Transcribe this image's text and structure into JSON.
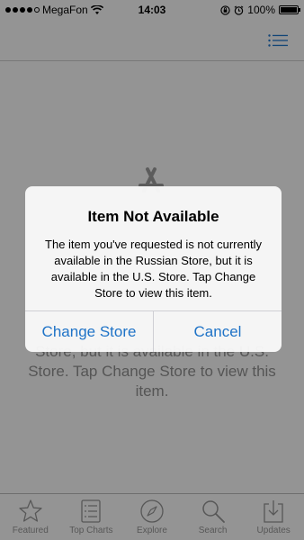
{
  "status_bar": {
    "carrier": "MegaFon",
    "time": "14:03",
    "battery_text": "100%",
    "battery_level": 1.0
  },
  "content": {
    "background_message": "Store, but it is available in the U.S. Store. Tap Change Store to view this item."
  },
  "alert": {
    "title": "Item Not Available",
    "message": "The item you've requested is not currently available in the Russian Store, but it is available in the U.S. Store. Tap Change Store to view this item.",
    "change_store_label": "Change Store",
    "cancel_label": "Cancel"
  },
  "tabs": [
    {
      "label": "Featured",
      "icon": "star-icon"
    },
    {
      "label": "Top Charts",
      "icon": "list-icon"
    },
    {
      "label": "Explore",
      "icon": "compass-icon"
    },
    {
      "label": "Search",
      "icon": "search-icon"
    },
    {
      "label": "Updates",
      "icon": "download-tray-icon"
    }
  ],
  "colors": {
    "accent": "#1f73c7",
    "inactive_tab": "#929292",
    "overlay": "rgba(0,0,0,0.40)"
  }
}
